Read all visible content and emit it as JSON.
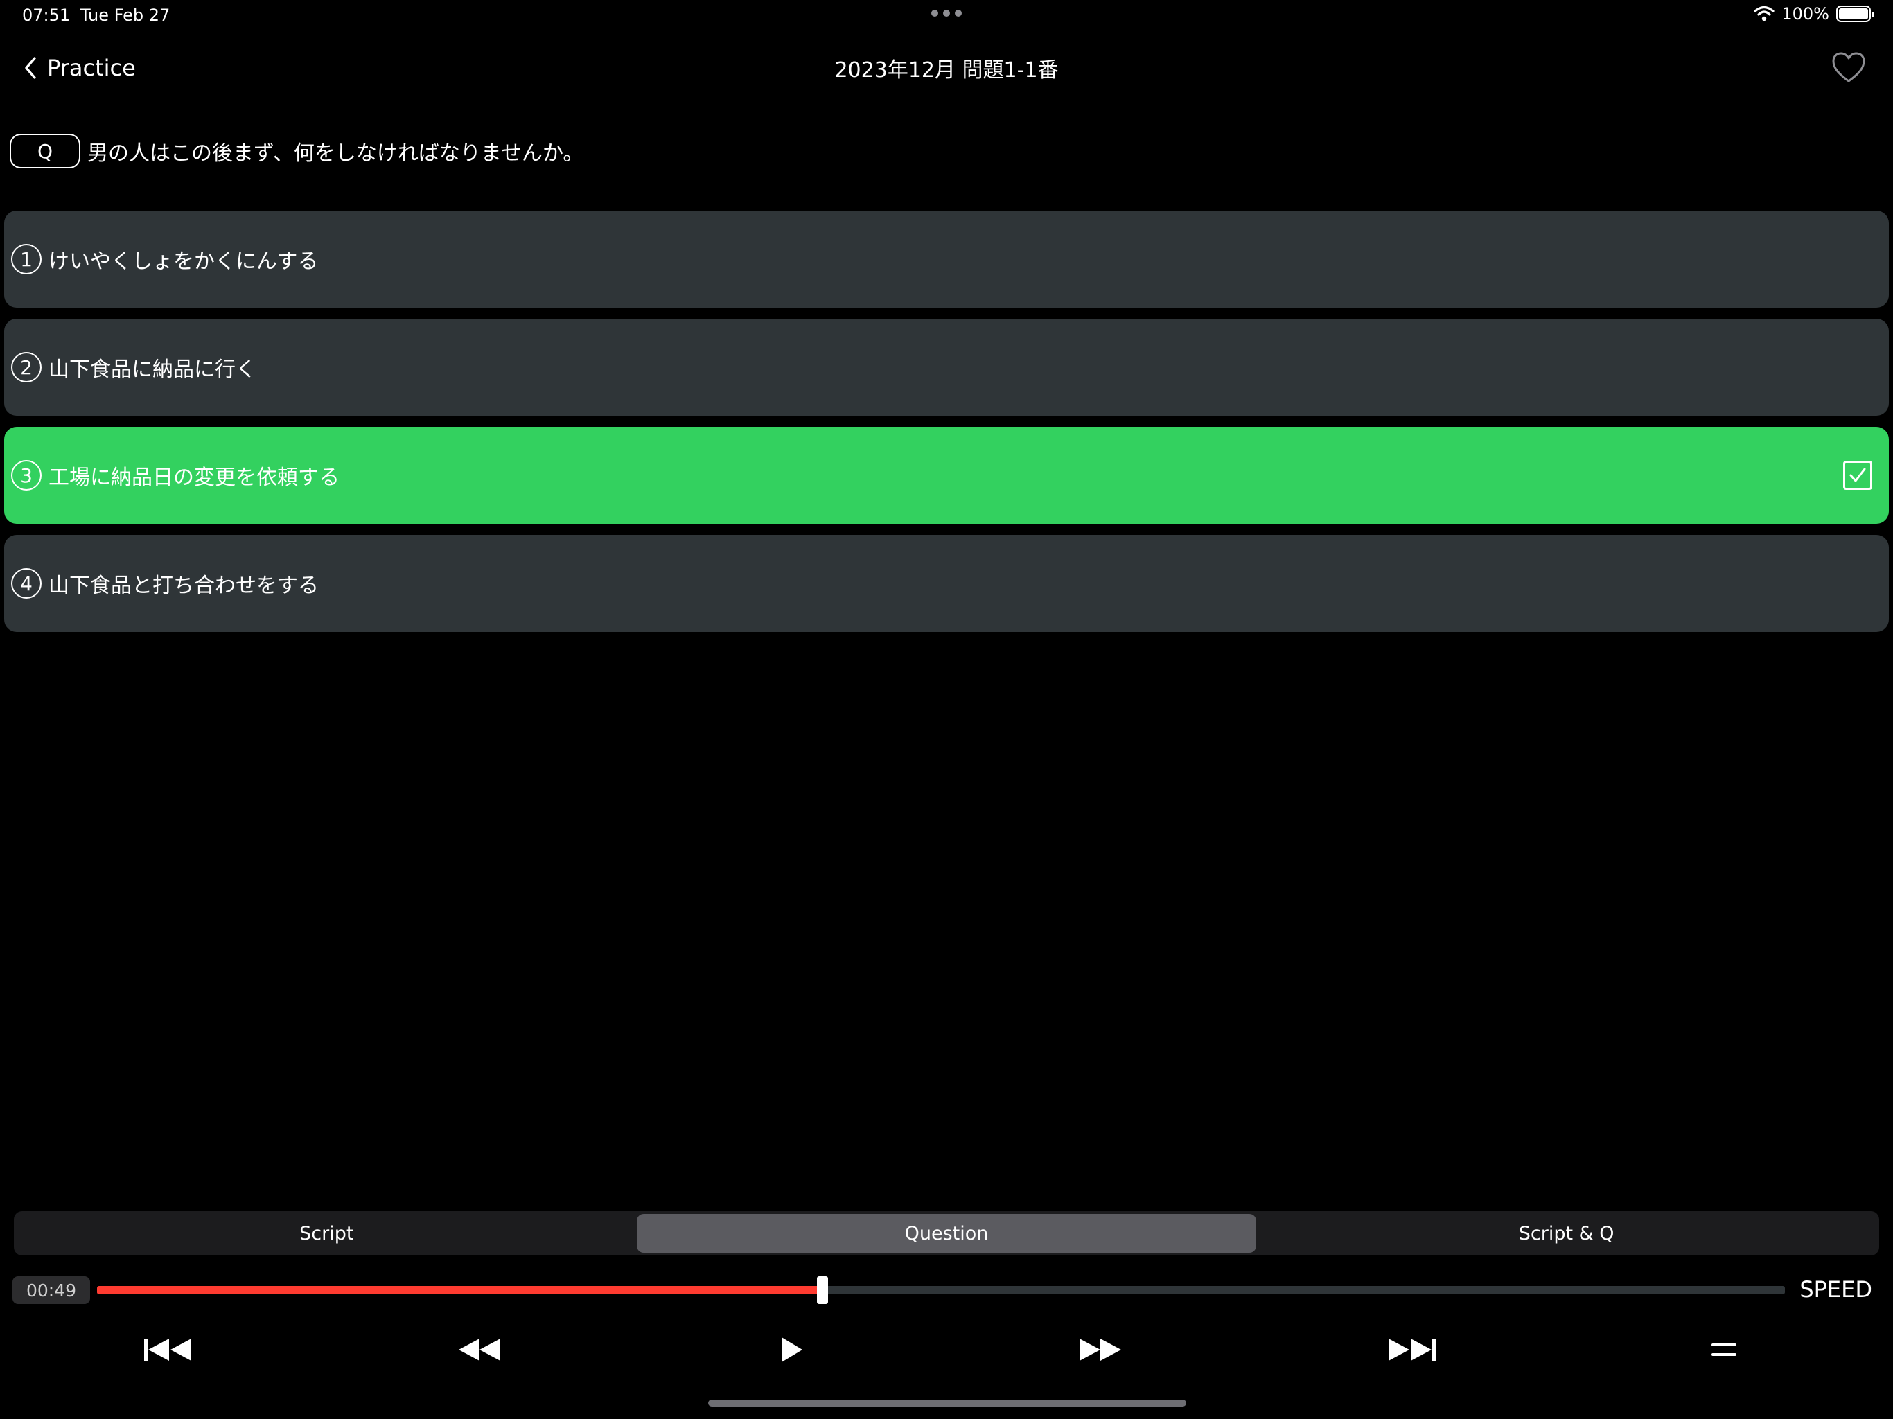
{
  "status": {
    "time": "07:51",
    "date": "Tue Feb 27",
    "battery": "100%"
  },
  "nav": {
    "back_label": "Practice",
    "title": "2023年12月 問題1-1番"
  },
  "question": {
    "badge": "Q",
    "text": "男の人はこの後まず、何をしなければなりませんか。"
  },
  "choices": [
    {
      "num": "1",
      "text": "けいやくしょをかくにんする"
    },
    {
      "num": "2",
      "text": "山下食品に納品に行く"
    },
    {
      "num": "3",
      "text": "工場に納品日の変更を依頼する"
    },
    {
      "num": "4",
      "text": "山下食品と打ち合わせをする"
    }
  ],
  "correct_index": 2,
  "tabs": [
    {
      "label": "Script"
    },
    {
      "label": "Question"
    },
    {
      "label": "Script & Q"
    }
  ],
  "active_tab": 1,
  "player": {
    "elapsed": "00:49",
    "progress": 0.43,
    "speed_label": "SPEED"
  },
  "icons": {
    "back": "chevron-left-icon",
    "favorite": "heart-outline-icon",
    "check": "checkbox-checked-icon",
    "skip_back": "skip-previous-icon",
    "rewind": "rewind-icon",
    "play": "play-icon",
    "fast_forward": "fast-forward-icon",
    "skip_forward": "skip-next-icon",
    "menu": "menu-icon"
  },
  "colors": {
    "background": "#000000",
    "card": "#2f3538",
    "correct": "#33d15f",
    "progress": "#ff3b30",
    "segment_active": "#5b5b60"
  }
}
